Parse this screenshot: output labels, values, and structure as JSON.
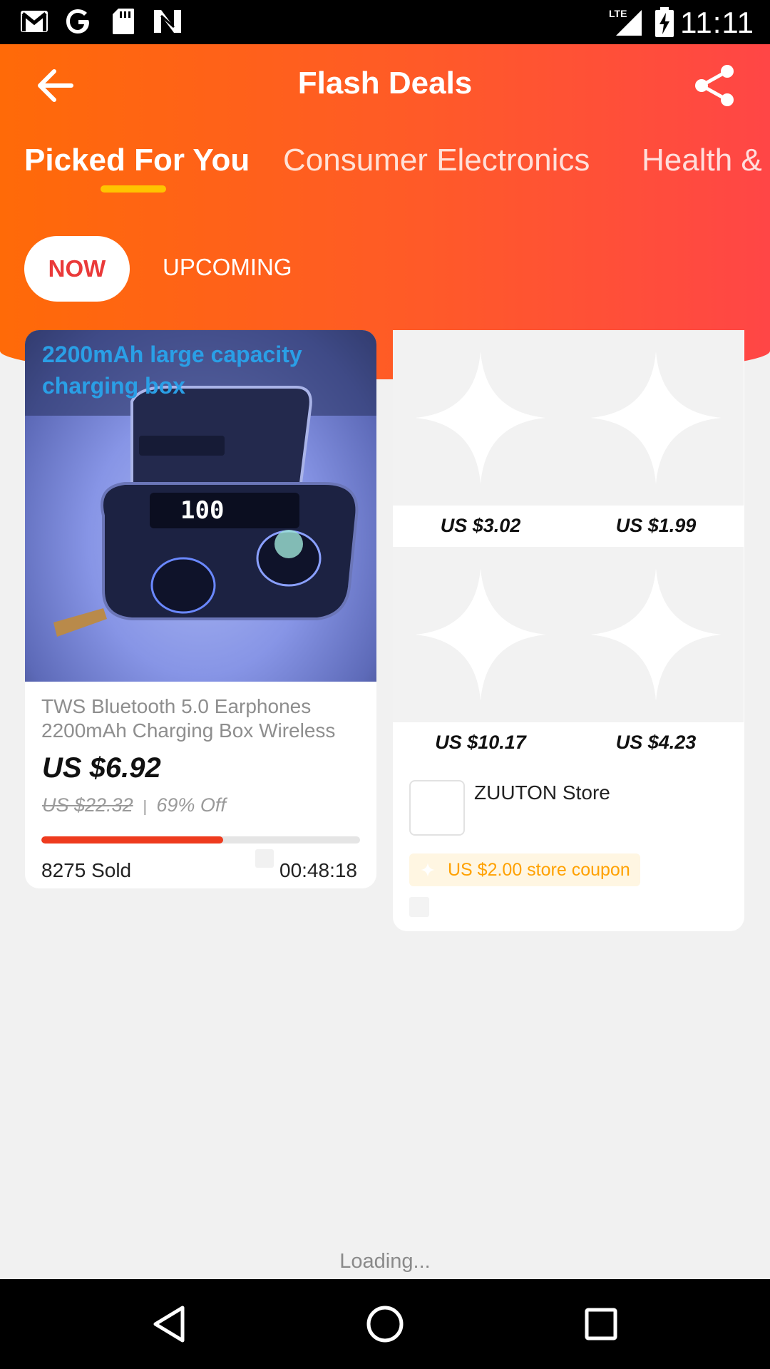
{
  "status_bar": {
    "time": "11:11",
    "left_icons": [
      "gmail-icon",
      "google-icon",
      "sd-card-icon",
      "n-icon"
    ],
    "right_icons": [
      "lte-signal-icon",
      "battery-charging-icon"
    ],
    "network": "LTE"
  },
  "header": {
    "title": "Flash Deals",
    "back_icon": "arrow-back-icon",
    "share_icon": "share-icon"
  },
  "tabs": [
    {
      "label": "Picked For You",
      "active": true
    },
    {
      "label": "Consumer Electronics",
      "active": false
    },
    {
      "label": "Health &",
      "active": false
    }
  ],
  "segment": {
    "now": "NOW",
    "upcoming": "UPCOMING"
  },
  "product": {
    "image_caption_line1": "2200mAh large capacity",
    "image_caption_line2": "charging box",
    "title": "TWS Bluetooth 5.0 Earphones 2200mAh Charging Box Wireless",
    "price": "US $6.92",
    "original_price": "US $22.32",
    "separator": "|",
    "discount": "69% Off",
    "sold": "8275 Sold",
    "timer": "00:48:18",
    "progress_fraction": 0.57
  },
  "store": {
    "prices": [
      "US $3.02",
      "US $1.99",
      "US $10.17",
      "US $4.23"
    ],
    "name": "ZUUTON Store",
    "coupon": "US $2.00 store coupon"
  },
  "loading_text": "Loading...",
  "colors": {
    "gradient_start": "#ff6a08",
    "gradient_end": "#ff4646",
    "accent_red": "#ea3a3a",
    "underline_yellow": "#ffc400",
    "coupon_orange": "#ffa100"
  },
  "nav": [
    "back-triangle-icon",
    "home-circle-icon",
    "recents-square-icon"
  ]
}
